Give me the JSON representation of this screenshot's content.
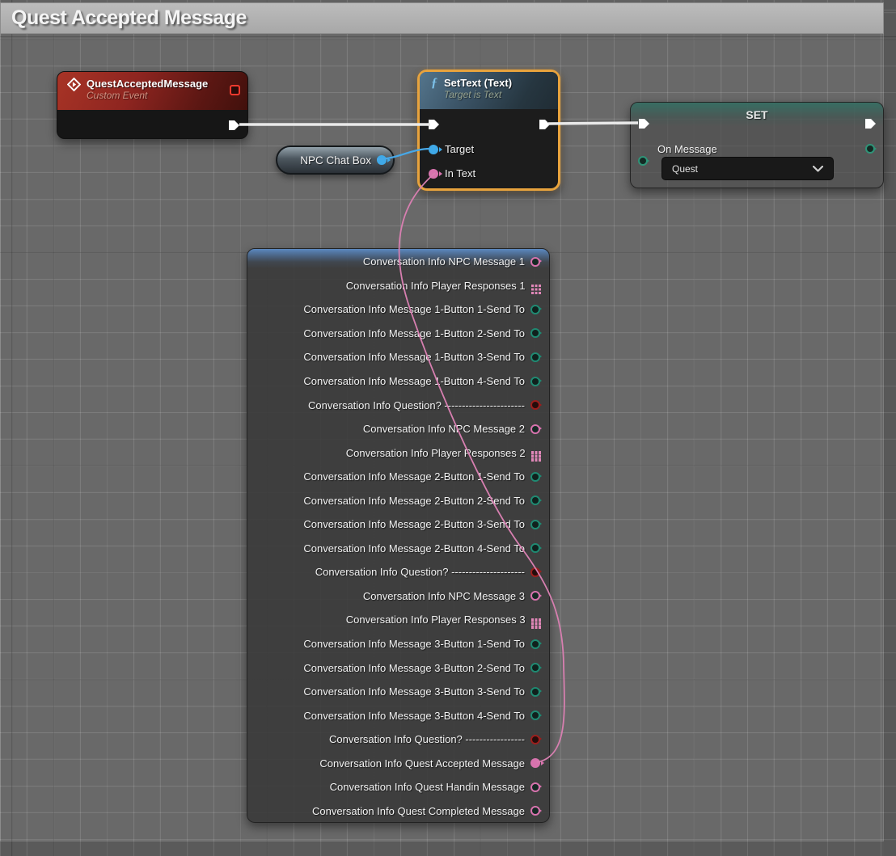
{
  "comment": {
    "title": "Quest Accepted Message"
  },
  "nodes": {
    "event": {
      "title": "QuestAcceptedMessage",
      "subtitle": "Custom Event"
    },
    "set_text": {
      "icon": "ƒ",
      "title": "SetText (Text)",
      "subtitle": "Target is Text",
      "pins": {
        "target": "Target",
        "in_text": "In Text"
      }
    },
    "npc_chat_box": {
      "label": "NPC Chat Box"
    },
    "set": {
      "title": "SET",
      "pin_label": "On Message",
      "dropdown_value": "Quest"
    },
    "conversation": {
      "pins": [
        {
          "label": "Conversation Info NPC Message 1",
          "type": "text"
        },
        {
          "label": "Conversation Info Player Responses 1",
          "type": "array"
        },
        {
          "label": "Conversation Info Message 1-Button 1-Send To",
          "type": "enum"
        },
        {
          "label": "Conversation Info Message 1-Button 2-Send To",
          "type": "enum"
        },
        {
          "label": "Conversation Info Message 1-Button 3-Send To",
          "type": "enum"
        },
        {
          "label": "Conversation Info Message 1-Button 4-Send To",
          "type": "enum"
        },
        {
          "label": "Conversation Info Question? -----------------------",
          "type": "bool"
        },
        {
          "label": "Conversation Info NPC Message 2",
          "type": "text"
        },
        {
          "label": "Conversation Info Player Responses 2",
          "type": "array"
        },
        {
          "label": "Conversation Info Message 2-Button 1-Send To",
          "type": "enum"
        },
        {
          "label": "Conversation Info Message 2-Button 2-Send To",
          "type": "enum"
        },
        {
          "label": "Conversation Info Message 2-Button 3-Send To",
          "type": "enum"
        },
        {
          "label": "Conversation Info Message 2-Button 4-Send To",
          "type": "enum"
        },
        {
          "label": "Conversation Info Question? ---------------------",
          "type": "bool"
        },
        {
          "label": "Conversation Info NPC Message 3",
          "type": "text"
        },
        {
          "label": "Conversation Info Player Responses 3",
          "type": "array"
        },
        {
          "label": "Conversation Info Message 3-Button 1-Send To",
          "type": "enum"
        },
        {
          "label": "Conversation Info Message 3-Button 2-Send To",
          "type": "enum"
        },
        {
          "label": "Conversation Info Message 3-Button 3-Send To",
          "type": "enum"
        },
        {
          "label": "Conversation Info Message 3-Button 4-Send To",
          "type": "enum"
        },
        {
          "label": "Conversation Info Question? -----------------",
          "type": "bool"
        },
        {
          "label": "Conversation Info Quest Accepted Message",
          "type": "text-connected"
        },
        {
          "label": "Conversation Info Quest Handin Message",
          "type": "text"
        },
        {
          "label": "Conversation Info Quest Completed Message",
          "type": "text"
        }
      ]
    }
  },
  "colors": {
    "exec_wire": "#e9e9e9",
    "object_wire": "#47a8e8",
    "text_wire": "#d77fb0",
    "text_pin": "#d873ae",
    "array_pin": "#e087b8",
    "enum_pin": "#1f8a72",
    "bool_pin": "#9c1e1c",
    "selection": "#e8a33d"
  }
}
